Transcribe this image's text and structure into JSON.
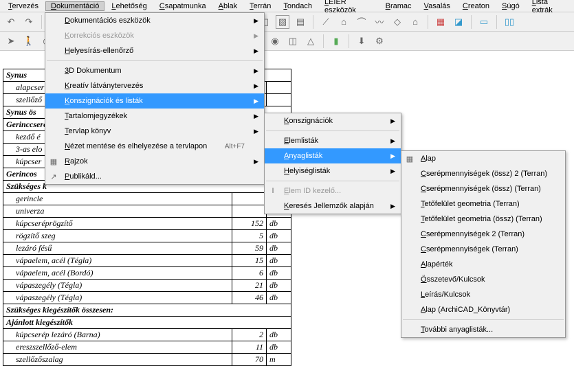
{
  "menubar": [
    "Tervezés",
    "Dokumentáció",
    "Lehetőség",
    "Csapatmunka",
    "Ablak",
    "Terrán",
    "Tondach",
    "LEIER eszközök",
    "Bramac",
    "Vasalás",
    "Creaton",
    "Súgó",
    "Lista extrák"
  ],
  "menu1": [
    {
      "t": "Dokumentációs eszközök",
      "arrow": true
    },
    {
      "t": "Korrekciós eszközök",
      "arrow": true,
      "disabled": true
    },
    {
      "t": "Helyesírás-ellenőrző",
      "arrow": true
    },
    {
      "sep": true
    },
    {
      "t": "3D Dokumentum",
      "arrow": true
    },
    {
      "t": "Kreatív látványtervezés",
      "arrow": true
    },
    {
      "t": "Konszignációk és listák",
      "arrow": true,
      "hl": true
    },
    {
      "t": "Tartalomjegyzékek",
      "arrow": true
    },
    {
      "t": "Tervlap könyv",
      "arrow": true
    },
    {
      "t": "Nézet mentése és elhelyezése a tervlapon",
      "shortcut": "Alt+F7"
    },
    {
      "t": "Rajzok",
      "arrow": true,
      "icon": "▦"
    },
    {
      "t": "Publikáld...",
      "icon": "↗"
    }
  ],
  "menu2": [
    {
      "t": "Konszignációk",
      "arrow": true
    },
    {
      "sep": true
    },
    {
      "t": "Elemlisták",
      "arrow": true
    },
    {
      "t": "Anyaglisták",
      "arrow": true,
      "hl": true
    },
    {
      "t": "Helyiséglisták",
      "arrow": true
    },
    {
      "sep": true
    },
    {
      "t": "Elem ID kezelő...",
      "disabled": true,
      "icon": "I"
    },
    {
      "t": "Keresés Jellemzők alapján",
      "arrow": true
    }
  ],
  "menu3": [
    "Alap",
    "Cserépmennyiségek (össz) 2 (Terran)",
    "Cserépmennyiségek (össz) (Terran)",
    "Tetőfelület geometria (Terran)",
    "Tetőfelület geometria (össz) (Terran)",
    "Cserépmennyiségek 2 (Terran)",
    "Cserépmennyiségek (Terran)",
    "Alapérték",
    "Összetevő/Kulcsok",
    "Leírás/Kulcsok",
    "Alap (ArchiCAD_Könyvtár)",
    "További anyaglisták..."
  ],
  "table": {
    "sections": [
      {
        "hdr": "Synus",
        "rows": [
          [
            "alapcser",
            "",
            " "
          ],
          [
            "szellőző",
            "",
            " "
          ]
        ]
      },
      {
        "hdr": "Synus ös"
      },
      {
        "hdr": "Gerinccsere",
        "rows": [
          [
            "kezdő é",
            "",
            " "
          ],
          [
            "3-as elo",
            "",
            " "
          ],
          [
            "kúpcser",
            "",
            " "
          ]
        ]
      },
      {
        "hdr": "Gerincos"
      },
      {
        "hdr": "Szükséges k",
        "rows": [
          [
            "gerincle",
            "",
            " "
          ],
          [
            "univerza",
            "",
            " "
          ],
          [
            "kúpcseréprögzítő",
            "152",
            "db"
          ],
          [
            "rögzítő szeg",
            "5",
            "db"
          ],
          [
            "lezáró fésű",
            "59",
            "db"
          ],
          [
            "vápaelem, acél (Tégla)",
            "15",
            "db"
          ],
          [
            "vápaelem, acél (Bordó)",
            "6",
            "db"
          ],
          [
            "vápaszegély (Tégla)",
            "21",
            "db"
          ],
          [
            "vápaszegély (Tégla)",
            "46",
            "db"
          ]
        ]
      },
      {
        "hdr": "Szükséges kiegészítők összesen:"
      },
      {
        "hdr": "Ajánlott kiegészítők",
        "rows": [
          [
            "kúpcserép lezáró (Barna)",
            "2",
            "db"
          ],
          [
            "ereszszellőző-elem",
            "11",
            "db"
          ],
          [
            "szellőzőszalag",
            "70",
            "m"
          ]
        ]
      }
    ]
  }
}
